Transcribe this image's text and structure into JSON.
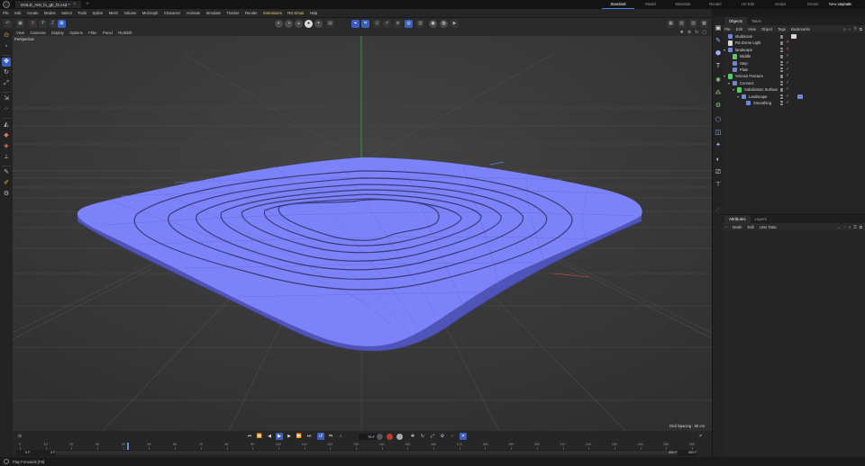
{
  "titlebar": {
    "document_tab": "GOLD_ANI_fo_gb_f3.c4d *",
    "layouts": [
      "Standard",
      "Model",
      "Materials",
      "Render",
      "UV Edit",
      "Sculpt",
      "Groom",
      "Animate"
    ],
    "active_layout": "Standard",
    "new_layouts": "New Layouts"
  },
  "menubar": {
    "items": [
      "File",
      "Edit",
      "Create",
      "Modes",
      "Select",
      "Tools",
      "Spline",
      "Mesh",
      "Volume",
      "MoGraph",
      "Character",
      "Animate",
      "Simulate",
      "Tracker",
      "Render",
      "Extensions",
      "RS-Xmas",
      "Help"
    ]
  },
  "toolbar": {
    "axis_x": "X",
    "axis_y": "Y",
    "axis_z": "Z"
  },
  "viewport": {
    "menu": [
      "View",
      "Cameras",
      "Display",
      "Options",
      "Filter",
      "Panel",
      "Redshift"
    ],
    "label": "Perspective",
    "grid_spacing": "Grid Spacing : 50 cm",
    "mesh_color": "#7c82f8"
  },
  "timeline": {
    "current_frame": "76 F",
    "ruler_labels": [
      "0",
      "10",
      "20",
      "30",
      "40",
      "50",
      "60",
      "70",
      "80",
      "90",
      "100",
      "110",
      "120",
      "130",
      "140",
      "150",
      "160",
      "170",
      "180",
      "190",
      "200",
      "210",
      "220",
      "230",
      "240",
      "250",
      "260"
    ],
    "start_field": "0 F",
    "start_field_2": "0 F",
    "end_field": "300 F",
    "end_field_2": "300 F"
  },
  "status": {
    "text": "Play Forwards [F8]"
  },
  "objects_panel": {
    "tabs": [
      "Objects",
      "Takes"
    ],
    "menu": [
      "File",
      "Edit",
      "View",
      "Object",
      "Tags",
      "Bookmarks"
    ],
    "rows": [
      {
        "name": "studiocam",
        "level": 0,
        "expand": "",
        "icon_color": "#6f86d9",
        "flag": "",
        "flag_color": "",
        "tag_color": "#d9d9d9"
      },
      {
        "name": "RS Dome Light",
        "level": 0,
        "expand": "",
        "icon_color": "#d9d9d9",
        "flag": "✕",
        "flag_color": "#e05050",
        "tag_color": ""
      },
      {
        "name": "landscape",
        "level": 0,
        "expand": "▾",
        "icon_color": "#6f86d9",
        "flag": "✕",
        "flag_color": "#e05050",
        "tag_color": ""
      },
      {
        "name": "Middle",
        "level": 1,
        "expand": "",
        "icon_color": "#58c86a",
        "flag": "✓",
        "flag_color": "#58c86a",
        "tag_color": ""
      },
      {
        "name": "Step",
        "level": 1,
        "expand": "",
        "icon_color": "#6f86d9",
        "flag": "✓",
        "flag_color": "#58c86a",
        "tag_color": ""
      },
      {
        "name": "Plain",
        "level": 1,
        "expand": "",
        "icon_color": "#6f86d9",
        "flag": "✓",
        "flag_color": "#58c86a",
        "tag_color": ""
      },
      {
        "name": "Voronoi Fracture",
        "level": 0,
        "expand": "▾",
        "icon_color": "#58c86a",
        "flag": "✓",
        "flag_color": "#58c86a",
        "tag_color": ""
      },
      {
        "name": "Connect",
        "level": 1,
        "expand": "▾",
        "icon_color": "#6f86d9",
        "flag": "✓",
        "flag_color": "#58c86a",
        "tag_color": ""
      },
      {
        "name": "Subdivision Surface",
        "level": 2,
        "expand": "▾",
        "icon_color": "#58c86a",
        "flag": "✓",
        "flag_color": "#58c86a",
        "tag_color": ""
      },
      {
        "name": "Landscape",
        "level": 3,
        "expand": "▾",
        "icon_color": "#6f86d9",
        "flag": "✓",
        "flag_color": "#58c86a",
        "tag_color": "#6f86d9"
      },
      {
        "name": "Smoothing",
        "level": 4,
        "expand": "",
        "icon_color": "#6f86d9",
        "flag": "✓",
        "flag_color": "#58c86a",
        "tag_color": ""
      }
    ]
  },
  "attributes_panel": {
    "tabs": [
      "Attributes",
      "Layers"
    ],
    "menu": [
      "Mode",
      "Edit",
      "User Data"
    ]
  }
}
